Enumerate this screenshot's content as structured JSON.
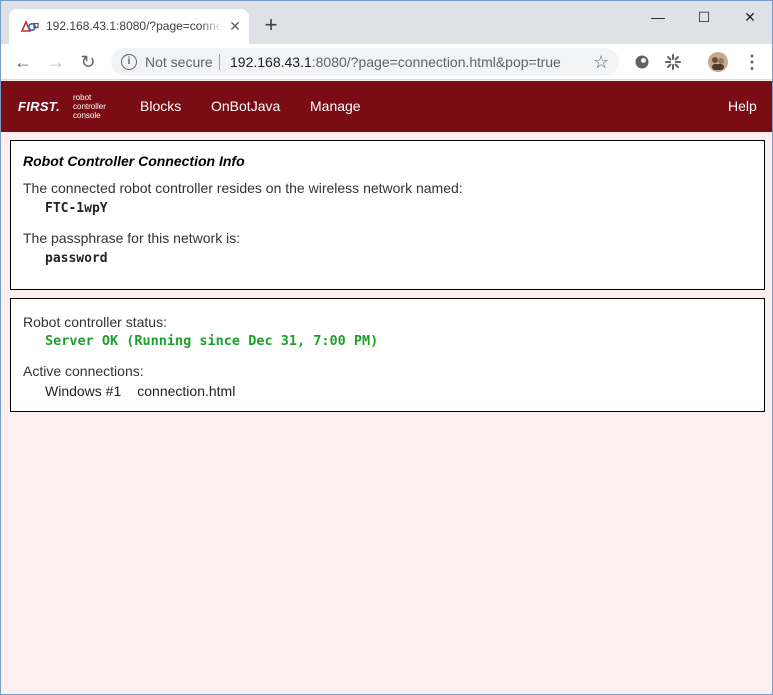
{
  "browser": {
    "tab_title": "192.168.43.1:8080/?page=connection.html&pop=true",
    "new_tab": "+",
    "tab_close": "✕",
    "minimize": "—",
    "maximize": "☐",
    "close": "✕",
    "security_label": "Not secure",
    "url_host": "192.168.43.1",
    "url_rest": ":8080/?page=connection.html&pop=true",
    "back": "←",
    "forward": "→",
    "reload": "↻",
    "star": "☆",
    "menu": "⋮"
  },
  "app": {
    "brand": "FIRST",
    "brand_sub_1": "robot",
    "brand_sub_2": "controller",
    "brand_sub_3": "console",
    "nav": [
      "Blocks",
      "OnBotJava",
      "Manage"
    ],
    "help": "Help",
    "header_color": "#7a0d13"
  },
  "connection_info": {
    "title": "Robot Controller Connection Info",
    "network_label": "The connected robot controller resides on the wireless network named:",
    "network_name": "FTC-1wpY",
    "passphrase_label": "The passphrase for this network is:",
    "passphrase": "password"
  },
  "status": {
    "label": "Robot controller status:",
    "value": "Server OK (Running since Dec 31, 7:00 PM)",
    "value_color": "#1e9e2a",
    "connections_label": "Active connections:",
    "connections": [
      {
        "client": "Windows #1",
        "page": "connection.html"
      }
    ]
  }
}
